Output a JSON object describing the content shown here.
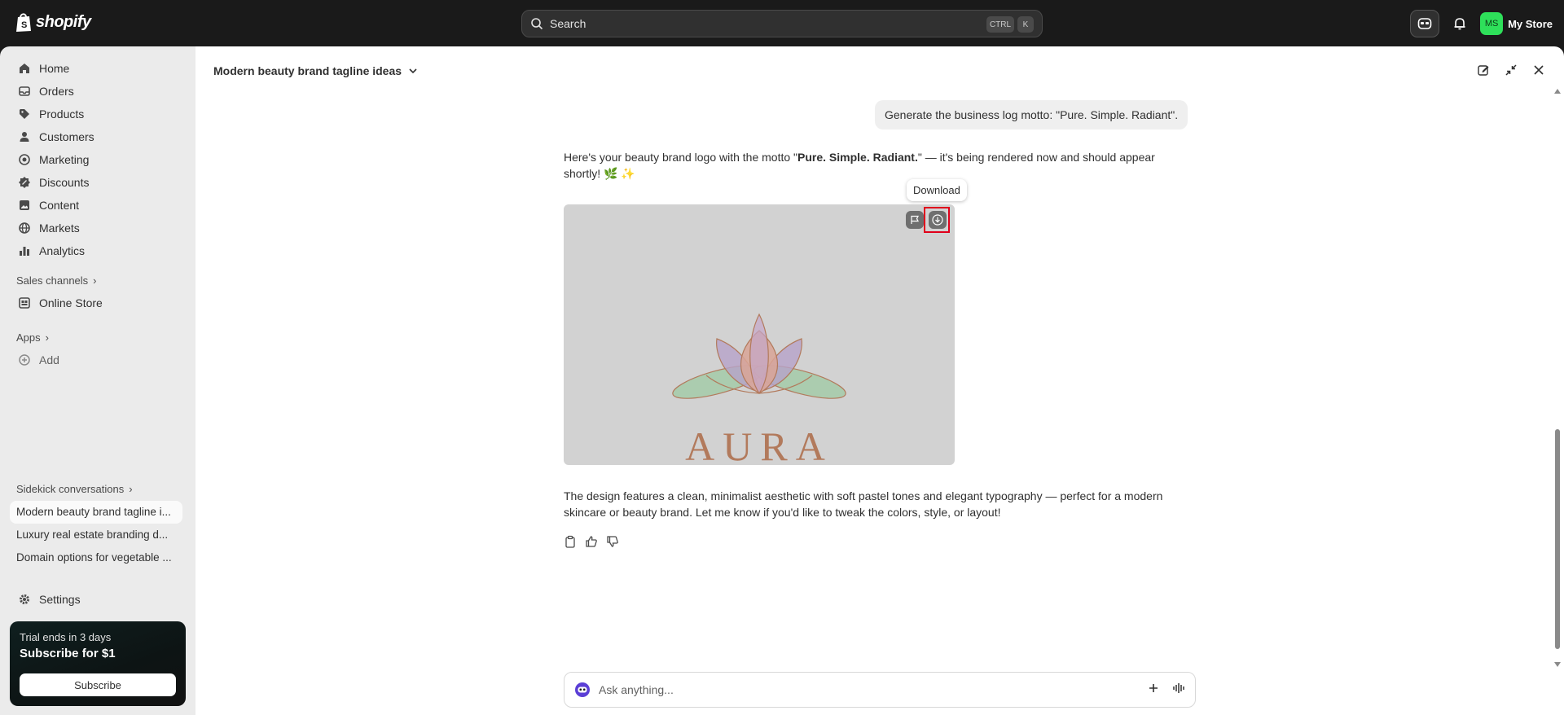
{
  "topbar": {
    "brand": "shopify",
    "search_placeholder": "Search",
    "shortcut_ctrl": "CTRL",
    "shortcut_k": "K",
    "store_initials": "MS",
    "store_name": "My Store"
  },
  "sidebar": {
    "nav": [
      {
        "label": "Home",
        "icon": "home-icon"
      },
      {
        "label": "Orders",
        "icon": "orders-icon"
      },
      {
        "label": "Products",
        "icon": "tag-icon"
      },
      {
        "label": "Customers",
        "icon": "person-icon"
      },
      {
        "label": "Marketing",
        "icon": "target-icon"
      },
      {
        "label": "Discounts",
        "icon": "discount-icon"
      },
      {
        "label": "Content",
        "icon": "content-icon"
      },
      {
        "label": "Markets",
        "icon": "globe-icon"
      },
      {
        "label": "Analytics",
        "icon": "bar-chart-icon"
      }
    ],
    "sales_channels_label": "Sales channels",
    "online_store": "Online Store",
    "apps_label": "Apps",
    "add_label": "Add",
    "sidekick_label": "Sidekick conversations",
    "conversations": [
      "Modern beauty brand tagline i...",
      "Luxury real estate branding d...",
      "Domain options for vegetable ..."
    ],
    "settings": "Settings",
    "trial": {
      "subtitle": "Trial ends in 3 days",
      "title": "Subscribe for $1",
      "button": "Subscribe"
    }
  },
  "conversation": {
    "title": "Modern beauty brand tagline ideas",
    "user_message": "Generate the business log motto: \"Pure. Simple. Radiant\".",
    "reply_intro": "Here's your beauty brand logo with the motto \"",
    "reply_bold": "Pure. Simple. Radiant.",
    "reply_rest": "\" — it's being rendered now and should appear shortly! 🌿 ✨",
    "tooltip": "Download",
    "logo_word": "AURA",
    "reply_after": "The design features a clean, minimalist aesthetic with soft pastel tones and elegant typography — perfect for a modern skincare or beauty brand. Let me know if you'd like to tweak the colors, style, or layout!",
    "composer_placeholder": "Ask anything..."
  },
  "colors": {
    "topbar_bg": "#1a1a1a",
    "sidebar_bg": "#ebebeb",
    "avatar_bg": "#2ee05a",
    "highlight": "#e0001b",
    "logo_text": "#b27a5c"
  }
}
